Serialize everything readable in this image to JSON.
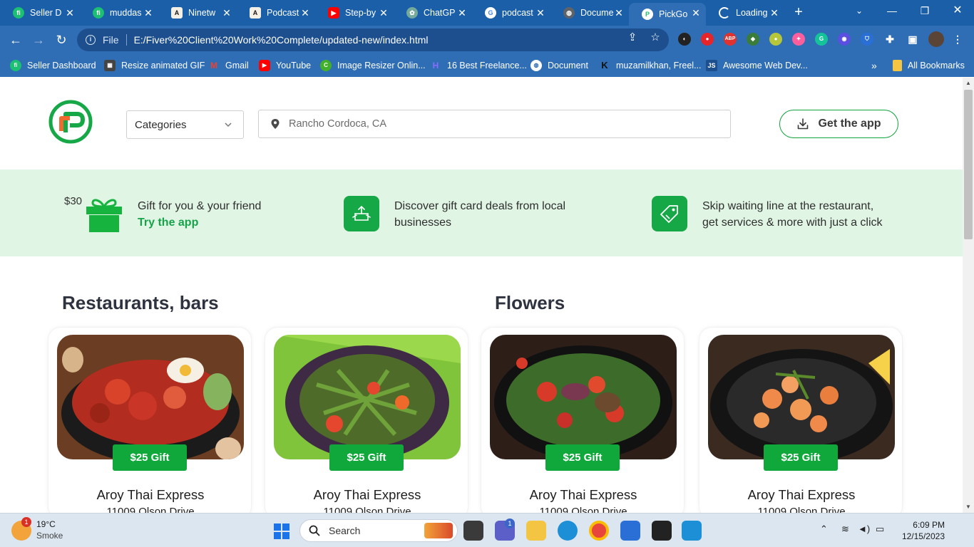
{
  "browser": {
    "tabs": [
      {
        "label": "Seller D",
        "icon": "fiverr-icon",
        "color": "#1dbf73"
      },
      {
        "label": "muddas",
        "icon": "fiverr-icon",
        "color": "#1dbf73"
      },
      {
        "label": "Ninetw",
        "icon": "anthropic-icon",
        "color": "#191919"
      },
      {
        "label": "Podcast",
        "icon": "anthropic-icon",
        "color": "#191919"
      },
      {
        "label": "Step-by",
        "icon": "youtube-icon",
        "color": "#ff0000"
      },
      {
        "label": "ChatGP",
        "icon": "chatgpt-icon",
        "color": "#74aa9c"
      },
      {
        "label": "podcast",
        "icon": "google-icon",
        "color": "#ffffff"
      },
      {
        "label": "Docume",
        "icon": "globe-icon",
        "color": "#5f6368"
      },
      {
        "label": "PickGo",
        "icon": "pickgo-icon",
        "color": "#1dbf73",
        "active": true
      },
      {
        "label": "Loading",
        "icon": "loading-icon",
        "color": "#ffffff"
      }
    ],
    "address": {
      "scheme": "File",
      "url": "E:/Fiver%20Client%20Work%20Complete/updated-new/index.html"
    },
    "bookmarks": [
      {
        "label": "Seller Dashboard",
        "icon": "fiverr-icon",
        "color": "#1dbf73"
      },
      {
        "label": "Resize animated GIF",
        "icon": "gif-icon",
        "color": "#444444"
      },
      {
        "label": "Gmail",
        "icon": "gmail-icon",
        "color": "#ea4335"
      },
      {
        "label": "YouTube",
        "icon": "youtube-icon",
        "color": "#ff0000"
      },
      {
        "label": "Image Resizer Onlin...",
        "icon": "resizer-icon",
        "color": "#43b02a"
      },
      {
        "label": "16 Best Freelance...",
        "icon": "h-icon",
        "color": "#6b4ce6"
      },
      {
        "label": "Document",
        "icon": "globe-icon",
        "color": "#ffffff"
      },
      {
        "label": "muzamilkhan, Freel...",
        "icon": "k-icon",
        "color": "#111111"
      },
      {
        "label": "Awesome Web Dev...",
        "icon": "js-icon",
        "color": "#1d4f8f"
      }
    ],
    "all_bookmarks": "All Bookmarks"
  },
  "site": {
    "categories_label": "Categories",
    "location_value": "Rancho Cordoca, CA",
    "get_app_label": "Get the app",
    "accent_color": "#10a83a"
  },
  "promo": {
    "gift_amount": "$30",
    "gift_text": "Gift for you & your friend",
    "gift_link": "Try the app",
    "deals_text_1": "Discover gift card deals from local",
    "deals_text_2": "businesses",
    "skip_text_1": "Skip waiting line at the restaurant,",
    "skip_text_2": "get services & more with just a click"
  },
  "sections": {
    "restaurants": "Restaurants, bars",
    "flowers": "Flowers"
  },
  "cards": [
    {
      "badge": "$25 Gift",
      "name": "Aroy Thai Express",
      "address": "11009 Olson Drive",
      "photo": "sausage-rice-bowl"
    },
    {
      "badge": "$25 Gift",
      "name": "Aroy Thai Express",
      "address": "11009 Olson Drive",
      "photo": "green-bean-stir-fry"
    },
    {
      "badge": "$25 Gift",
      "name": "Aroy Thai Express",
      "address": "11009 Olson Drive",
      "photo": "tomato-salad-bowl"
    },
    {
      "badge": "$25 Gift",
      "name": "Aroy Thai Express",
      "address": "11009 Olson Drive",
      "photo": "shrimp-pan"
    }
  ],
  "taskbar": {
    "weather_temp": "19°C",
    "weather_cond": "Smoke",
    "weather_badge": "1",
    "search_label": "Search",
    "teams_badge": "1",
    "time": "6:09 PM",
    "date": "12/15/2023"
  }
}
